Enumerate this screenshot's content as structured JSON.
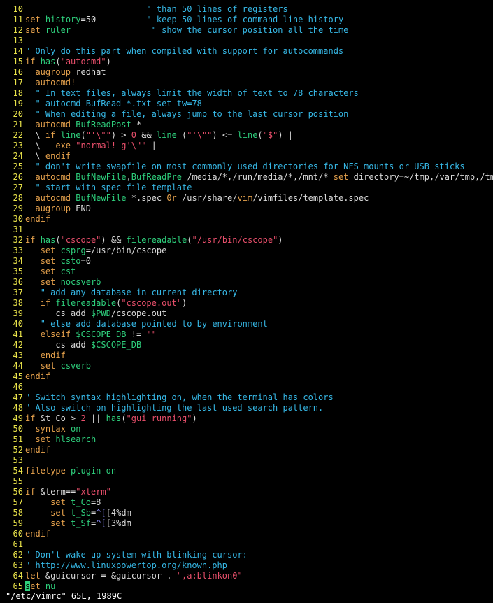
{
  "editor": {
    "name": "vim",
    "file_path": "/etc/vimrc",
    "colors": {
      "background": "#000000",
      "line_number": "#e9e34a",
      "text": "#d8d8d8",
      "statement": "#e6a24d",
      "identifier": "#2ecf7c",
      "constant": "#e84f6b",
      "comment": "#36b8e6",
      "special": "#8f8fff"
    }
  },
  "lines": [
    {
      "num": "10",
      "segs": [
        [
          "s",
          "                        "
        ],
        [
          "cmt",
          "\" than 50 lines of registers"
        ]
      ]
    },
    {
      "num": "11",
      "segs": [
        [
          "stmt",
          "set"
        ],
        [
          "s",
          " "
        ],
        [
          "ident",
          "history"
        ],
        [
          "s",
          "=50          "
        ],
        [
          "cmt",
          "\" keep 50 lines of command line history"
        ]
      ]
    },
    {
      "num": "12",
      "segs": [
        [
          "stmt",
          "set"
        ],
        [
          "s",
          " "
        ],
        [
          "ident",
          "ruler"
        ],
        [
          "s",
          "                "
        ],
        [
          "cmt",
          "\" show the cursor position all the time"
        ]
      ]
    },
    {
      "num": "13",
      "segs": []
    },
    {
      "num": "14",
      "segs": [
        [
          "cmt",
          "\" Only do this part when compiled with support for autocommands"
        ]
      ]
    },
    {
      "num": "15",
      "segs": [
        [
          "stmt",
          "if"
        ],
        [
          "s",
          " "
        ],
        [
          "ident",
          "has"
        ],
        [
          "s",
          "("
        ],
        [
          "const",
          "\"autocmd\""
        ],
        [
          "s",
          ")"
        ]
      ]
    },
    {
      "num": "16",
      "segs": [
        [
          "s",
          "  "
        ],
        [
          "stmt",
          "augroup"
        ],
        [
          "s",
          " redhat"
        ]
      ]
    },
    {
      "num": "17",
      "segs": [
        [
          "s",
          "  "
        ],
        [
          "stmt",
          "autocmd!"
        ]
      ]
    },
    {
      "num": "18",
      "segs": [
        [
          "s",
          "  "
        ],
        [
          "cmt",
          "\" In text files, always limit the width of text to 78 characters"
        ]
      ]
    },
    {
      "num": "19",
      "segs": [
        [
          "s",
          "  "
        ],
        [
          "cmt",
          "\" autocmd BufRead *.txt set tw=78"
        ]
      ]
    },
    {
      "num": "20",
      "segs": [
        [
          "s",
          "  "
        ],
        [
          "cmt",
          "\" When editing a file, always jump to the last cursor position"
        ]
      ]
    },
    {
      "num": "21",
      "segs": [
        [
          "s",
          "  "
        ],
        [
          "stmt",
          "autocmd"
        ],
        [
          "s",
          " "
        ],
        [
          "ident",
          "BufReadPost"
        ],
        [
          "s",
          " *"
        ]
      ]
    },
    {
      "num": "22",
      "segs": [
        [
          "s",
          "  \\ "
        ],
        [
          "stmt",
          "if"
        ],
        [
          "s",
          " "
        ],
        [
          "ident",
          "line"
        ],
        [
          "s",
          "("
        ],
        [
          "const",
          "\"'\\\"\""
        ],
        [
          "s",
          ") > "
        ],
        [
          "const",
          "0"
        ],
        [
          "s",
          " && "
        ],
        [
          "ident",
          "line"
        ],
        [
          "s",
          " ("
        ],
        [
          "const",
          "\"'\\\"\""
        ],
        [
          "s",
          ") <= "
        ],
        [
          "ident",
          "line"
        ],
        [
          "s",
          "("
        ],
        [
          "const",
          "\"$\""
        ],
        [
          "s",
          ") |"
        ]
      ]
    },
    {
      "num": "23",
      "segs": [
        [
          "s",
          "  \\   "
        ],
        [
          "stmt",
          "exe"
        ],
        [
          "s",
          " "
        ],
        [
          "const",
          "\"normal! g'\\\"\""
        ],
        [
          "s",
          " |"
        ]
      ]
    },
    {
      "num": "24",
      "segs": [
        [
          "s",
          "  \\ "
        ],
        [
          "stmt",
          "endif"
        ]
      ]
    },
    {
      "num": "25",
      "segs": [
        [
          "s",
          "  "
        ],
        [
          "cmt",
          "\" don't write swapfile on most commonly used directories for NFS mounts or USB sticks"
        ]
      ]
    },
    {
      "num": "26",
      "segs": [
        [
          "s",
          "  "
        ],
        [
          "stmt",
          "autocmd"
        ],
        [
          "s",
          " "
        ],
        [
          "ident",
          "BufNewFile"
        ],
        [
          "s",
          ","
        ],
        [
          "ident",
          "BufReadPre"
        ],
        [
          "s",
          " /media/*,/run/media/*,/mnt/* "
        ],
        [
          "stmt",
          "set"
        ],
        [
          "s",
          " directory=~/tmp,/var/tmp,/tmp"
        ]
      ]
    },
    {
      "num": "27",
      "segs": [
        [
          "s",
          "  "
        ],
        [
          "cmt",
          "\" start with spec file template"
        ]
      ]
    },
    {
      "num": "28",
      "segs": [
        [
          "s",
          "  "
        ],
        [
          "stmt",
          "autocmd"
        ],
        [
          "s",
          " "
        ],
        [
          "ident",
          "BufNewFile"
        ],
        [
          "s",
          " *.spec "
        ],
        [
          "stmt",
          "0r"
        ],
        [
          "s",
          " /usr/share/"
        ],
        [
          "stmt",
          "vim"
        ],
        [
          "s",
          "/vimfiles/template.spec"
        ]
      ]
    },
    {
      "num": "29",
      "segs": [
        [
          "s",
          "  "
        ],
        [
          "stmt",
          "augroup"
        ],
        [
          "s",
          " END"
        ]
      ]
    },
    {
      "num": "30",
      "segs": [
        [
          "stmt",
          "endif"
        ]
      ]
    },
    {
      "num": "31",
      "segs": []
    },
    {
      "num": "32",
      "segs": [
        [
          "stmt",
          "if"
        ],
        [
          "s",
          " "
        ],
        [
          "ident",
          "has"
        ],
        [
          "s",
          "("
        ],
        [
          "const",
          "\"cscope\""
        ],
        [
          "s",
          ") && "
        ],
        [
          "ident",
          "filereadable"
        ],
        [
          "s",
          "("
        ],
        [
          "const",
          "\"/usr/bin/cscope\""
        ],
        [
          "s",
          ")"
        ]
      ]
    },
    {
      "num": "33",
      "segs": [
        [
          "s",
          "   "
        ],
        [
          "stmt",
          "set"
        ],
        [
          "s",
          " "
        ],
        [
          "ident",
          "csprg"
        ],
        [
          "s",
          "=/usr/bin/cscope"
        ]
      ]
    },
    {
      "num": "34",
      "segs": [
        [
          "s",
          "   "
        ],
        [
          "stmt",
          "set"
        ],
        [
          "s",
          " "
        ],
        [
          "ident",
          "csto"
        ],
        [
          "s",
          "=0"
        ]
      ]
    },
    {
      "num": "35",
      "segs": [
        [
          "s",
          "   "
        ],
        [
          "stmt",
          "set"
        ],
        [
          "s",
          " "
        ],
        [
          "ident",
          "cst"
        ]
      ]
    },
    {
      "num": "36",
      "segs": [
        [
          "s",
          "   "
        ],
        [
          "stmt",
          "set"
        ],
        [
          "s",
          " "
        ],
        [
          "ident",
          "nocsverb"
        ]
      ]
    },
    {
      "num": "37",
      "segs": [
        [
          "s",
          "   "
        ],
        [
          "cmt",
          "\" add any database in current directory"
        ]
      ]
    },
    {
      "num": "38",
      "segs": [
        [
          "s",
          "   "
        ],
        [
          "stmt",
          "if"
        ],
        [
          "s",
          " "
        ],
        [
          "ident",
          "filereadable"
        ],
        [
          "s",
          "("
        ],
        [
          "const",
          "\"cscope.out\""
        ],
        [
          "s",
          ")"
        ]
      ]
    },
    {
      "num": "39",
      "segs": [
        [
          "s",
          "      cs add "
        ],
        [
          "ident",
          "$PWD"
        ],
        [
          "s",
          "/cscope.out"
        ]
      ]
    },
    {
      "num": "40",
      "segs": [
        [
          "s",
          "   "
        ],
        [
          "cmt",
          "\" else add database pointed to by environment"
        ]
      ]
    },
    {
      "num": "41",
      "segs": [
        [
          "s",
          "   "
        ],
        [
          "stmt",
          "elseif"
        ],
        [
          "s",
          " "
        ],
        [
          "ident",
          "$CSCOPE_DB"
        ],
        [
          "s",
          " != "
        ],
        [
          "const",
          "\"\""
        ]
      ]
    },
    {
      "num": "42",
      "segs": [
        [
          "s",
          "      cs add "
        ],
        [
          "ident",
          "$CSCOPE_DB"
        ]
      ]
    },
    {
      "num": "43",
      "segs": [
        [
          "s",
          "   "
        ],
        [
          "stmt",
          "endif"
        ]
      ]
    },
    {
      "num": "44",
      "segs": [
        [
          "s",
          "   "
        ],
        [
          "stmt",
          "set"
        ],
        [
          "s",
          " "
        ],
        [
          "ident",
          "csverb"
        ]
      ]
    },
    {
      "num": "45",
      "segs": [
        [
          "stmt",
          "endif"
        ]
      ]
    },
    {
      "num": "46",
      "segs": []
    },
    {
      "num": "47",
      "segs": [
        [
          "cmt",
          "\" Switch syntax highlighting on, when the terminal has colors"
        ]
      ]
    },
    {
      "num": "48",
      "segs": [
        [
          "cmt",
          "\" Also switch on highlighting the last used search pattern."
        ]
      ]
    },
    {
      "num": "49",
      "segs": [
        [
          "stmt",
          "if"
        ],
        [
          "s",
          " &t_Co > "
        ],
        [
          "const",
          "2"
        ],
        [
          "s",
          " || "
        ],
        [
          "ident",
          "has"
        ],
        [
          "s",
          "("
        ],
        [
          "const",
          "\"gui_running\""
        ],
        [
          "s",
          ")"
        ]
      ]
    },
    {
      "num": "50",
      "segs": [
        [
          "s",
          "  "
        ],
        [
          "stmt",
          "syntax"
        ],
        [
          "s",
          " "
        ],
        [
          "ident",
          "on"
        ]
      ]
    },
    {
      "num": "51",
      "segs": [
        [
          "s",
          "  "
        ],
        [
          "stmt",
          "set"
        ],
        [
          "s",
          " "
        ],
        [
          "ident",
          "hlsearch"
        ]
      ]
    },
    {
      "num": "52",
      "segs": [
        [
          "stmt",
          "endif"
        ]
      ]
    },
    {
      "num": "53",
      "segs": []
    },
    {
      "num": "54",
      "segs": [
        [
          "stmt",
          "filetype"
        ],
        [
          "s",
          " "
        ],
        [
          "ident",
          "plugin"
        ],
        [
          "s",
          " "
        ],
        [
          "ident",
          "on"
        ]
      ]
    },
    {
      "num": "55",
      "segs": []
    },
    {
      "num": "56",
      "segs": [
        [
          "stmt",
          "if"
        ],
        [
          "s",
          " &term=="
        ],
        [
          "const",
          "\"xterm\""
        ]
      ]
    },
    {
      "num": "57",
      "segs": [
        [
          "s",
          "     "
        ],
        [
          "stmt",
          "set"
        ],
        [
          "s",
          " "
        ],
        [
          "ident",
          "t_Co"
        ],
        [
          "s",
          "=8"
        ]
      ]
    },
    {
      "num": "58",
      "segs": [
        [
          "s",
          "     "
        ],
        [
          "stmt",
          "set"
        ],
        [
          "s",
          " "
        ],
        [
          "ident",
          "t_Sb"
        ],
        [
          "s",
          "="
        ],
        [
          "spec",
          "^["
        ],
        [
          "s",
          "[4%dm"
        ]
      ]
    },
    {
      "num": "59",
      "segs": [
        [
          "s",
          "     "
        ],
        [
          "stmt",
          "set"
        ],
        [
          "s",
          " "
        ],
        [
          "ident",
          "t_Sf"
        ],
        [
          "s",
          "="
        ],
        [
          "spec",
          "^["
        ],
        [
          "s",
          "[3%dm"
        ]
      ]
    },
    {
      "num": "60",
      "segs": [
        [
          "stmt",
          "endif"
        ]
      ]
    },
    {
      "num": "61",
      "segs": []
    },
    {
      "num": "62",
      "segs": [
        [
          "cmt",
          "\" Don't wake up system with blinking cursor:"
        ]
      ]
    },
    {
      "num": "63",
      "segs": [
        [
          "cmt",
          "\" http://www.linuxpowertop.org/known.php"
        ]
      ]
    },
    {
      "num": "64",
      "segs": [
        [
          "stmt",
          "let"
        ],
        [
          "s",
          " &guicursor = &guicursor . "
        ],
        [
          "const",
          "\",a:blinkon0\""
        ]
      ]
    },
    {
      "num": "65",
      "segs": [
        [
          "cursor",
          "s"
        ],
        [
          "stmt",
          "et"
        ],
        [
          "s",
          " "
        ],
        [
          "ident",
          "nu"
        ]
      ]
    }
  ],
  "status_line": {
    "text": "\"/etc/vimrc\" 65L, 1989C"
  }
}
